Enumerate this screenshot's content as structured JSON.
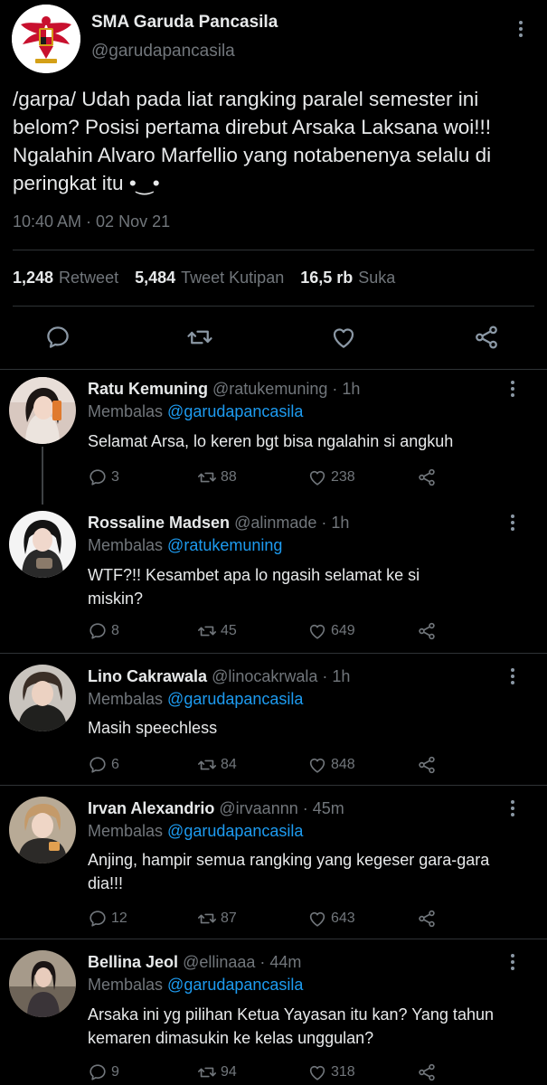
{
  "main_tweet": {
    "display_name": "SMA Garuda Pancasila",
    "handle": "@garudapancasila",
    "text": "/garpa/ Udah pada liat rangking paralel semester ini belom? Posisi pertama direbut Arsaka Laksana woi!!! Ngalahin Alvaro Marfellio yang notabenenya selalu di peringkat itu  •‿•",
    "timestamp": "10:40 AM · 02 Nov 21",
    "stats": {
      "retweet_count": "1,248",
      "retweet_label": "Retweet",
      "quote_count": "5,484",
      "quote_label": "Tweet Kutipan",
      "like_count": "16,5 rb",
      "like_label": "Suka"
    },
    "icons": [
      "reply-icon",
      "retweet-icon",
      "like-icon",
      "share-icon"
    ]
  },
  "replies": [
    {
      "display_name": "Ratu Kemuning",
      "handle": "@ratukemuning",
      "age": "· 1h",
      "replying_label": "Membalas",
      "replying_to": "@garudapancasila",
      "text": "Selamat Arsa, lo keren bgt bisa ngalahin si angkuh",
      "replies": "3",
      "retweets": "88",
      "likes": "238"
    },
    {
      "display_name": "Rossaline Madsen",
      "handle": "@alinmade",
      "age": "· 1h",
      "replying_label": "Membalas",
      "replying_to": "@ratukemuning",
      "text": "WTF?!! Kesambet apa lo ngasih selamat ke si miskin?",
      "replies": "8",
      "retweets": "45",
      "likes": "649"
    },
    {
      "display_name": "Lino Cakrawala",
      "handle": "@linocakrwala",
      "age": "· 1h",
      "replying_label": "Membalas",
      "replying_to": "@garudapancasila",
      "text": "Masih speechless",
      "replies": "6",
      "retweets": "84",
      "likes": "848"
    },
    {
      "display_name": "Irvan Alexandrio",
      "handle": "@irvaannn",
      "age": "· 45m",
      "replying_label": "Membalas",
      "replying_to": "@garudapancasila",
      "text": "Anjing, hampir semua rangking yang kegeser gara-gara dia!!!",
      "replies": "12",
      "retweets": "87",
      "likes": "643"
    },
    {
      "display_name": "Bellina Jeol",
      "handle": "@ellinaaa",
      "age": "· 44m",
      "replying_label": "Membalas",
      "replying_to": "@garudapancasila",
      "text": "Arsaka ini yg pilihan Ketua Yayasan itu kan? Yang tahun kemaren dimasukin ke kelas unggulan?",
      "replies": "9",
      "retweets": "94",
      "likes": "318"
    }
  ],
  "colors": {
    "background": "#000000",
    "primary_text": "#e7e9ea",
    "secondary_text": "#71767b",
    "link": "#1d9bf0",
    "divider": "#2f3336"
  }
}
